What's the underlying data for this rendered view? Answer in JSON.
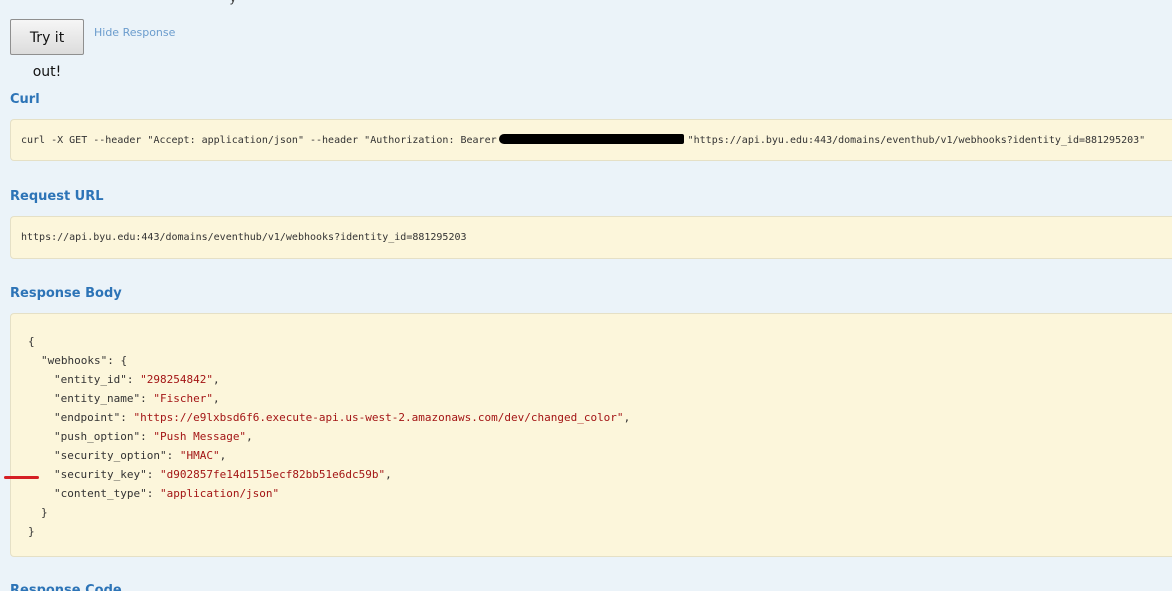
{
  "top_partial_text": "y",
  "try_button": "Try it out!",
  "hide_response": "Hide Response",
  "curl": {
    "title": "Curl",
    "prefix": "curl -X GET --header \"Accept: application/json\" --header \"Authorization: Bearer",
    "suffix": "\"https://api.byu.edu:443/domains/eventhub/v1/webhooks?identity_id=881295203\""
  },
  "request_url": {
    "title": "Request URL",
    "value": "https://api.byu.edu:443/domains/eventhub/v1/webhooks?identity_id=881295203"
  },
  "response_body": {
    "title": "Response Body",
    "lines": [
      {
        "text": "{"
      },
      {
        "key": "\"webhooks\"",
        "sep": ": ",
        "value": "{"
      },
      {
        "key": "\"entity_id\"",
        "sep": ": ",
        "value": "\"298254842\"",
        "tail": ","
      },
      {
        "key": "\"entity_name\"",
        "sep": ": ",
        "value": "\"Fischer\"",
        "tail": ","
      },
      {
        "key": "\"endpoint\"",
        "sep": ": ",
        "value": "\"https://e9lxbsd6f6.execute-api.us-west-2.amazonaws.com/dev/changed_color\"",
        "tail": ","
      },
      {
        "key": "\"push_option\"",
        "sep": ": ",
        "value": "\"Push Message\"",
        "tail": ","
      },
      {
        "key": "\"security_option\"",
        "sep": ": ",
        "value": "\"HMAC\"",
        "tail": ","
      },
      {
        "key": "\"security_key\"",
        "sep": ": ",
        "value": "\"d902857fe14d1515ecf82bb51e6dc59b\"",
        "tail": ","
      },
      {
        "key": "\"content_type\"",
        "sep": ": ",
        "value": "\"application/json\""
      },
      {
        "text": "}"
      },
      {
        "text": "}"
      }
    ]
  },
  "response_code": {
    "title": "Response Code"
  },
  "colors": {
    "background": "#ebf3f9",
    "panel": "#fcf6db",
    "heading": "#2d74b7",
    "link": "#6b9ccd",
    "json_string": "#a31515",
    "marker": "#d61f24"
  }
}
